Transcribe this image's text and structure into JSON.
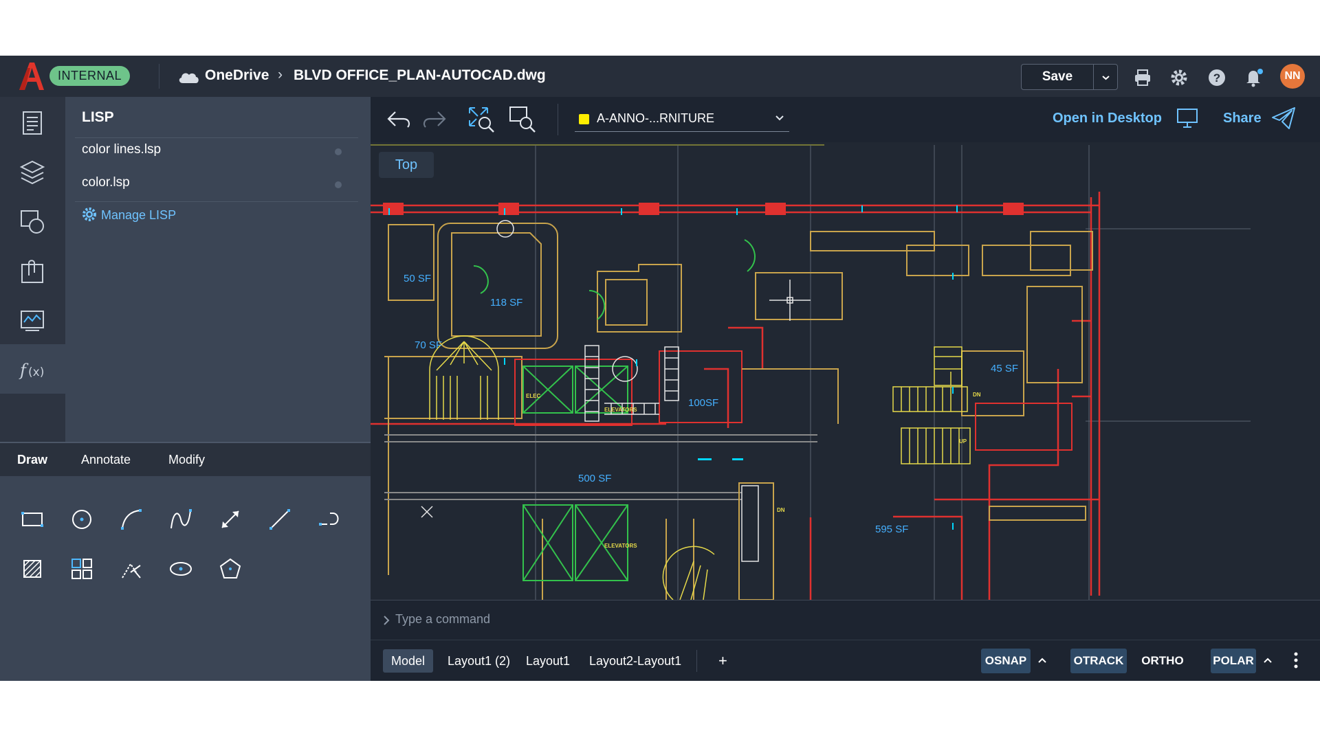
{
  "app": {
    "badge": "INTERNAL",
    "location": "OneDrive",
    "filename": "BLVD OFFICE_PLAN-AUTOCAD.dwg",
    "save_label": "Save",
    "avatar_initials": "NN",
    "brand_color": "#e0352b"
  },
  "lisp_panel": {
    "title": "LISP",
    "items": [
      {
        "label": "color lines.lsp"
      },
      {
        "label": "color.lsp"
      }
    ],
    "manage_label": "Manage LISP"
  },
  "draw_tabs": {
    "tabs": [
      "Draw",
      "Annotate",
      "Modify"
    ],
    "active": "Draw",
    "tools": [
      "rectangle-icon",
      "circle-icon",
      "arc-icon",
      "spline-icon",
      "dimension-icon",
      "line-icon",
      "polyline-icon",
      "hatch-icon",
      "array-icon",
      "trim-icon",
      "ellipse-icon",
      "polygon-icon"
    ]
  },
  "canvas_toolbar": {
    "layer_name": "A-ANNO-...RNITURE",
    "layer_color": "#ffee00",
    "open_in_desktop": "Open in Desktop",
    "share": "Share"
  },
  "drawing": {
    "view_label": "Top",
    "room_labels": [
      "50 SF",
      "118 SF",
      "70 SF",
      "100SF",
      "45 SF",
      "500 SF",
      "595 SF"
    ],
    "tag_labels": [
      "ELEVATORS",
      "ELEVATORS",
      "ELEC",
      "DN",
      "DN",
      "UP"
    ]
  },
  "command_line": {
    "placeholder": "Type a command"
  },
  "status_bar": {
    "layouts": [
      "Model",
      "Layout1 (2)",
      "Layout1",
      "Layout2-Layout1"
    ],
    "active_layout": "Model",
    "add_layout_label": "+",
    "toggles": [
      {
        "label": "OSNAP",
        "on": true
      },
      {
        "label": "OTRACK",
        "on": true
      },
      {
        "label": "ORTHO",
        "on": false
      },
      {
        "label": "POLAR",
        "on": true
      }
    ]
  }
}
